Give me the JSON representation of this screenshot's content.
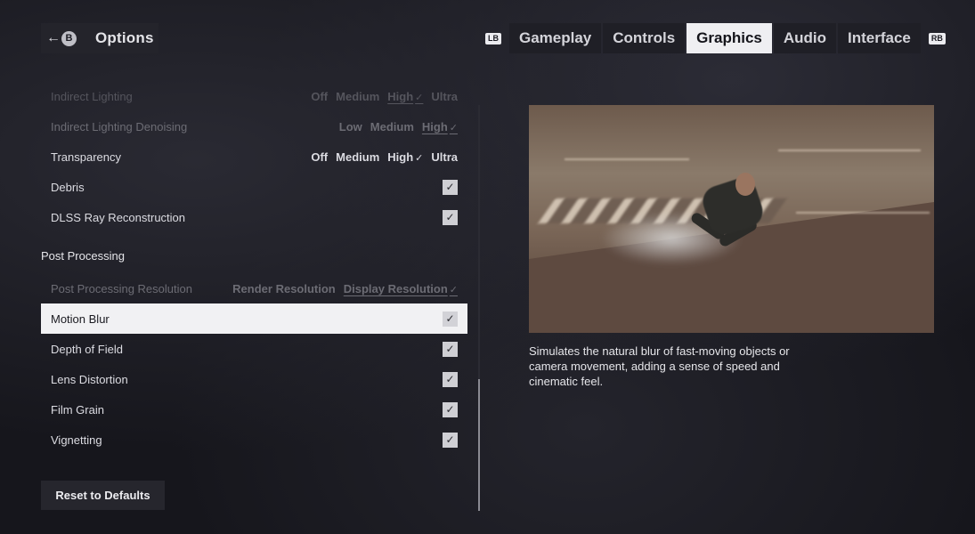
{
  "header": {
    "back_badge": "B",
    "title": "Options",
    "bumper_left": "LB",
    "bumper_right": "RB",
    "tabs": [
      "Gameplay",
      "Controls",
      "Graphics",
      "Audio",
      "Interface"
    ],
    "active_tab": "Graphics"
  },
  "settings": {
    "indirect_lighting": {
      "label": "Indirect Lighting",
      "options": [
        "Off",
        "Medium",
        "High",
        "Ultra"
      ],
      "selected": "High"
    },
    "indirect_lighting_denoising": {
      "label": "Indirect Lighting Denoising",
      "options": [
        "Low",
        "Medium",
        "High"
      ],
      "selected": "High"
    },
    "transparency": {
      "label": "Transparency",
      "options": [
        "Off",
        "Medium",
        "High",
        "Ultra"
      ],
      "selected": "High"
    },
    "debris": {
      "label": "Debris",
      "checked": true
    },
    "dlss_ray_reconstruction": {
      "label": "DLSS Ray Reconstruction",
      "checked": true
    },
    "post_processing_section": "Post Processing",
    "post_processing_resolution": {
      "label": "Post Processing Resolution",
      "options": [
        "Render Resolution",
        "Display Resolution"
      ],
      "selected": "Display Resolution"
    },
    "motion_blur": {
      "label": "Motion Blur",
      "checked": true
    },
    "depth_of_field": {
      "label": "Depth of Field",
      "checked": true
    },
    "lens_distortion": {
      "label": "Lens Distortion",
      "checked": true
    },
    "film_grain": {
      "label": "Film Grain",
      "checked": true
    },
    "vignetting": {
      "label": "Vignetting",
      "checked": true
    }
  },
  "reset_label": "Reset to Defaults",
  "description": "Simulates the natural blur of fast-moving objects or camera movement, adding a sense of speed and cinematic feel.",
  "icons": {
    "back": "arrow-left-icon",
    "check": "checkmark-icon"
  },
  "colors": {
    "background": "#16161c",
    "active_tab_bg": "#efeff2",
    "selected_row_bg": "#f1f1f3"
  }
}
